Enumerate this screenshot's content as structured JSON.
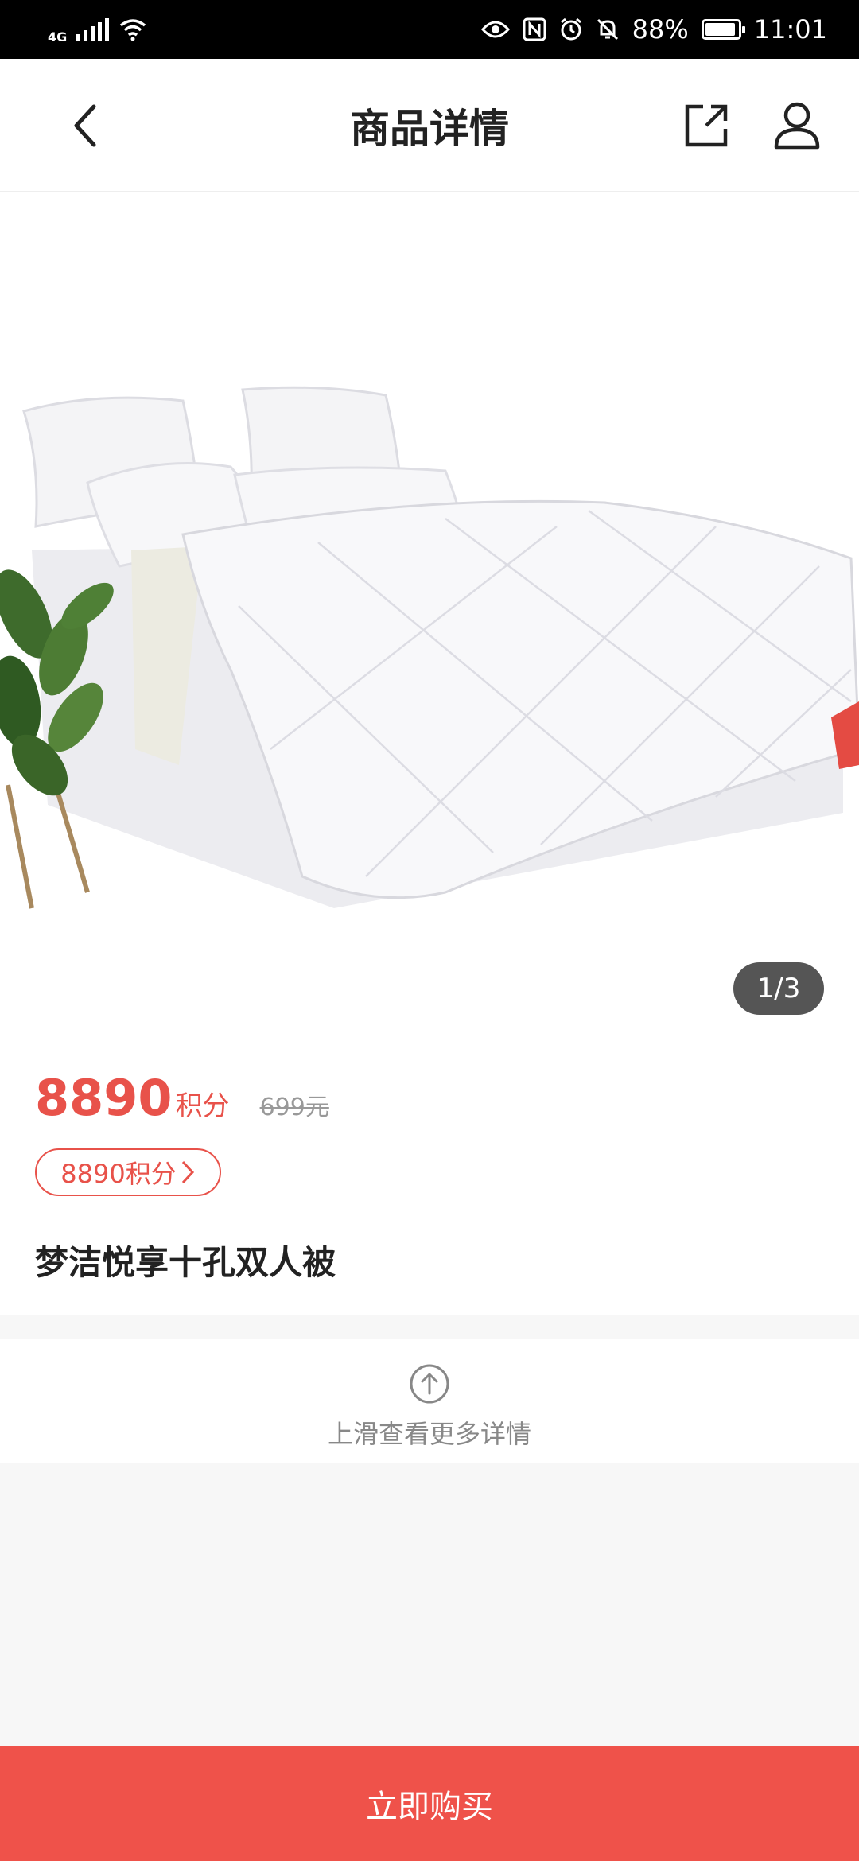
{
  "status_bar": {
    "network": "4G",
    "battery": "88%",
    "time": "11:01",
    "icons": [
      "signal-icon",
      "wifi-icon",
      "eye-icon",
      "nfc-icon",
      "alarm-icon",
      "mute-icon",
      "battery-icon"
    ]
  },
  "header": {
    "title": "商品详情",
    "back_icon": "chevron-left-icon",
    "share_icon": "share-icon",
    "user_icon": "user-icon"
  },
  "gallery": {
    "counter": "1/3",
    "image": "white-duvet-bed-image"
  },
  "product": {
    "price_value": "8890",
    "price_unit": "积分",
    "original_price": "699元",
    "points_chip": "8890积分",
    "name": "梦洁悦享十孔双人被"
  },
  "swipe_hint": {
    "text": "上滑查看更多详情",
    "icon": "arrow-up-circle-icon"
  },
  "buy_button": {
    "label": "立即购买"
  },
  "colors": {
    "accent": "#ef524a",
    "text": "#222222",
    "muted": "#999999"
  }
}
